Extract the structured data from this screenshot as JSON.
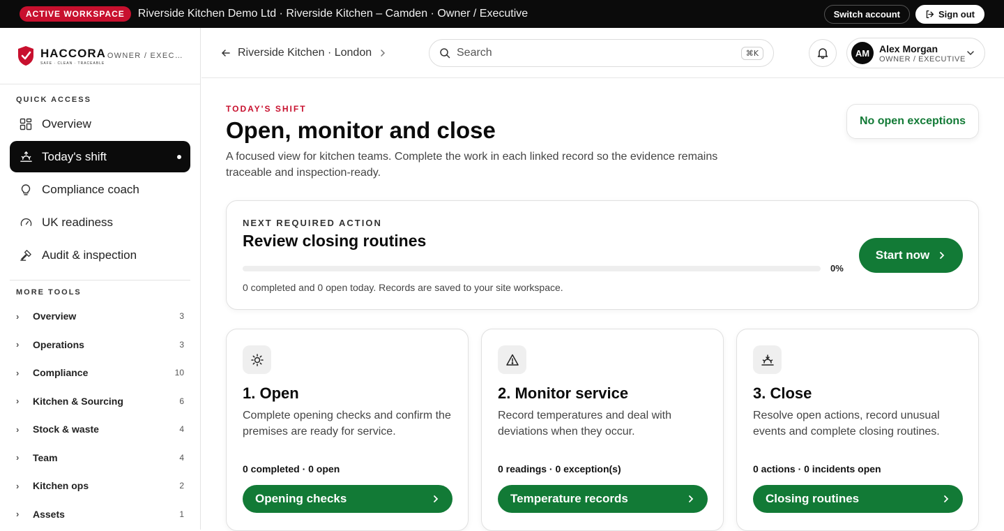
{
  "topbar": {
    "badge": "ACTIVE WORKSPACE",
    "context": "Riverside Kitchen Demo Ltd · Riverside Kitchen – Camden · Owner / Executive",
    "switch_account": "Switch account",
    "sign_out": "Sign out"
  },
  "brand": {
    "name": "HACCORA",
    "tagline": "SAFE · CLEAN · TRACEABLE",
    "role": "OWNER / EXEC…"
  },
  "sidebar": {
    "quick_access_label": "QUICK ACCESS",
    "quick_access": [
      {
        "label": "Overview",
        "icon": "grid-icon"
      },
      {
        "label": "Today's shift",
        "icon": "shift-icon",
        "active": true
      },
      {
        "label": "Compliance coach",
        "icon": "lightbulb-icon"
      },
      {
        "label": "UK readiness",
        "icon": "gauge-icon"
      },
      {
        "label": "Audit & inspection",
        "icon": "gavel-icon"
      }
    ],
    "more_tools_label": "MORE TOOLS",
    "more_tools": [
      {
        "label": "Overview",
        "count": "3"
      },
      {
        "label": "Operations",
        "count": "3"
      },
      {
        "label": "Compliance",
        "count": "10"
      },
      {
        "label": "Kitchen & Sourcing",
        "count": "6"
      },
      {
        "label": "Stock & waste",
        "count": "4"
      },
      {
        "label": "Team",
        "count": "4"
      },
      {
        "label": "Kitchen ops",
        "count": "2"
      },
      {
        "label": "Assets",
        "count": "1"
      }
    ]
  },
  "header": {
    "breadcrumb": "Riverside Kitchen · London",
    "search_placeholder": "Search",
    "search_shortcut": "⌘K",
    "user_initials": "AM",
    "user_name": "Alex Morgan",
    "user_role": "OWNER / EXECUTIVE"
  },
  "main": {
    "eyebrow": "TODAY'S SHIFT",
    "title": "Open, monitor and close",
    "lead": "A focused view for kitchen teams. Complete the work in each linked record so the evidence remains traceable and inspection-ready.",
    "exceptions_badge": "No open exceptions",
    "next_action": {
      "label": "NEXT REQUIRED ACTION",
      "title": "Review closing routines",
      "progress_fraction": 0,
      "progress_text": "0%",
      "note": "0 completed and 0 open today. Records are saved to your site workspace.",
      "button": "Start now"
    },
    "steps": [
      {
        "icon": "sun-icon",
        "title": "1. Open",
        "description": "Complete opening checks and confirm the premises are ready for service.",
        "stat": "0 completed · 0 open",
        "button": "Opening checks"
      },
      {
        "icon": "warning-icon",
        "title": "2. Monitor service",
        "description": "Record temperatures and deal with deviations when they occur.",
        "stat": "0 readings · 0 exception(s)",
        "button": "Temperature records"
      },
      {
        "icon": "sunset-icon",
        "title": "3. Close",
        "description": "Resolve open actions, record unusual events and complete closing routines.",
        "stat": "0 actions · 0 incidents open",
        "button": "Closing routines"
      }
    ]
  },
  "colors": {
    "accent_red": "#c8102e",
    "primary_green": "#127a36",
    "dark": "#0b0b0b"
  }
}
